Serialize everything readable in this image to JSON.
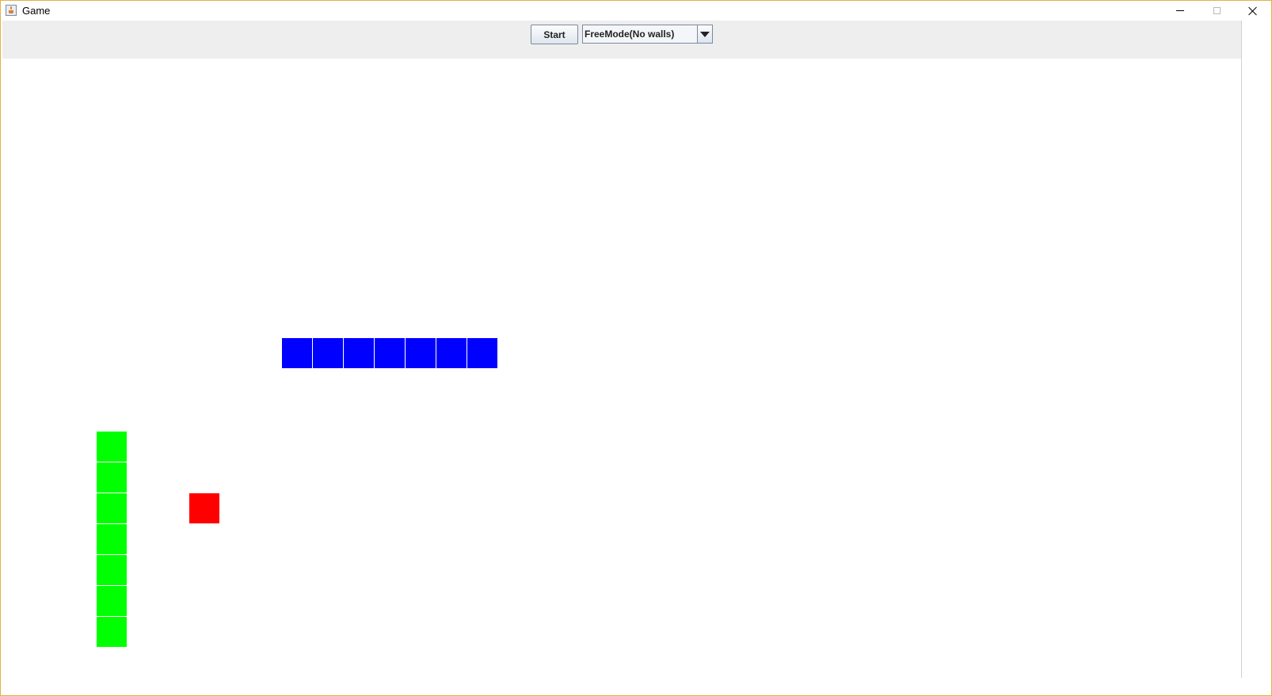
{
  "window": {
    "title": "Game",
    "controls": [
      "minimize-icon",
      "maximize-icon",
      "close-icon"
    ]
  },
  "toolbar": {
    "start_label": "Start",
    "mode_selected": "FreeMode(No walls)"
  },
  "colors": {
    "snake_blue": "#0000ff",
    "snake_green": "#00ff00",
    "food": "#ff0000",
    "toolbar_bg": "#eeeeee",
    "board_bg": "#ffffff"
  },
  "board": {
    "blue_snake_segments": 7,
    "green_snake_segments": 7,
    "food_count": 1
  }
}
